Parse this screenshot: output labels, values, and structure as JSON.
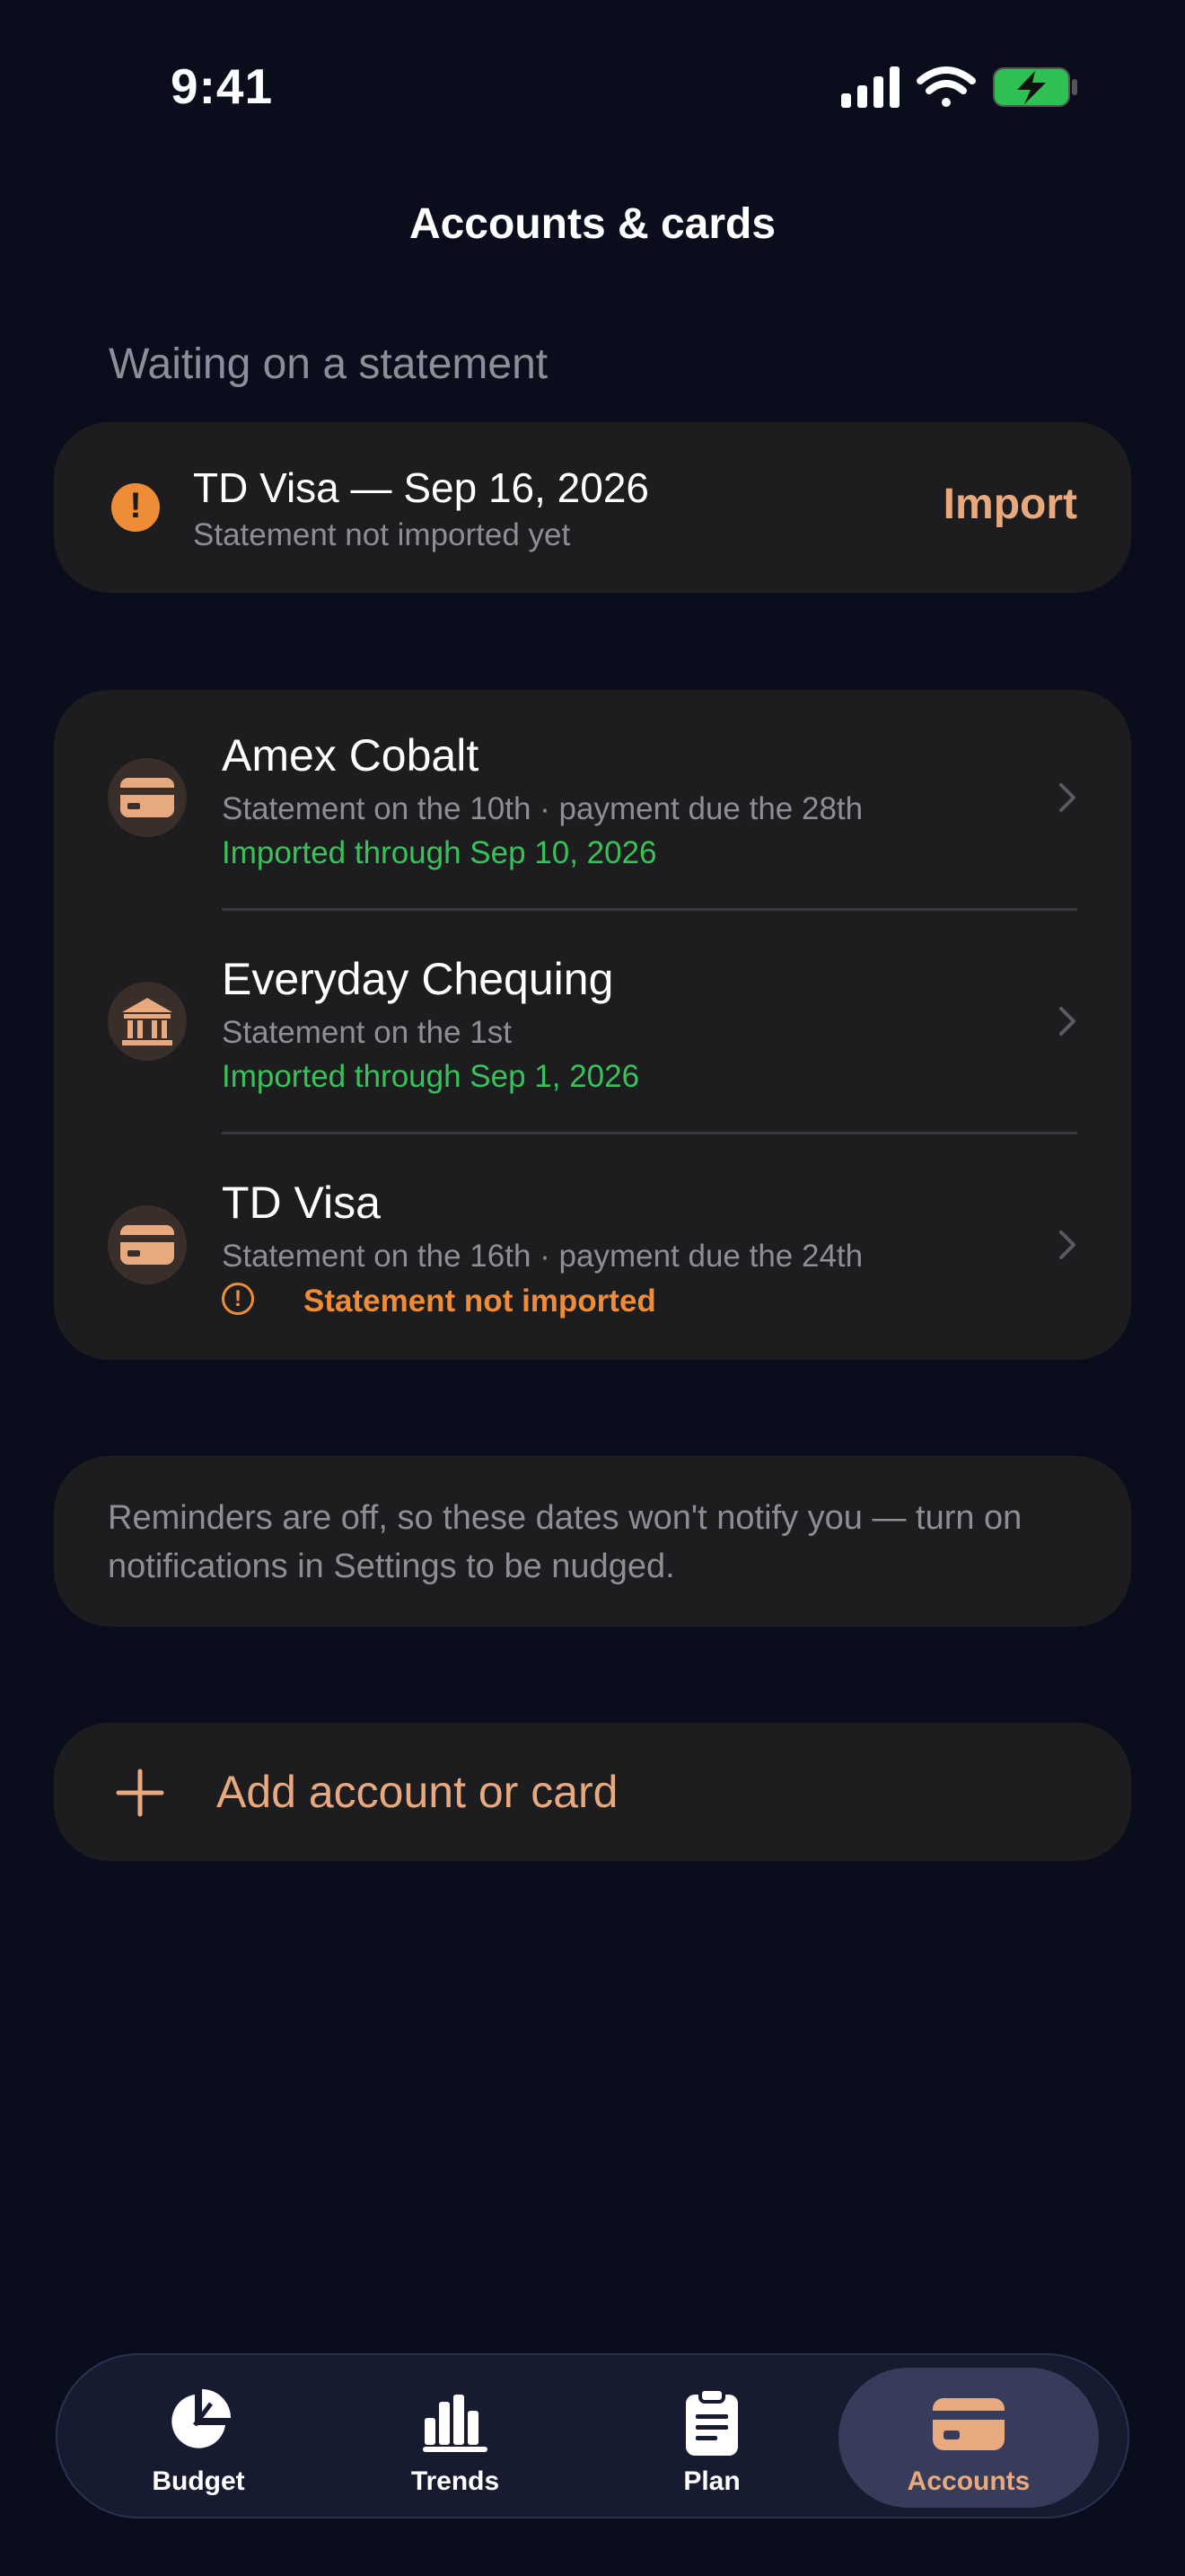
{
  "status_bar": {
    "time": "9:41"
  },
  "nav": {
    "title": "Accounts & cards"
  },
  "waiting": {
    "section_label": "Waiting on a statement",
    "item": {
      "title": "TD Visa — Sep 16, 2026",
      "subtitle": "Statement not imported yet",
      "action": "Import"
    }
  },
  "accounts": [
    {
      "name": "Amex Cobalt",
      "schedule": "Statement on the 10th · payment due the 28th",
      "status": "Imported through Sep 10, 2026",
      "status_kind": "ok",
      "icon": "credit-card-icon"
    },
    {
      "name": "Everyday Chequing",
      "schedule": "Statement on the 1st",
      "status": "Imported through Sep 1, 2026",
      "status_kind": "ok",
      "icon": "bank-icon"
    },
    {
      "name": "TD Visa",
      "schedule": "Statement on the 16th · payment due the 24th",
      "status": "Statement not imported",
      "status_kind": "warning",
      "icon": "credit-card-icon"
    }
  ],
  "note": "Reminders are off, so these dates won't notify you — turn on notifications in Settings to be nudged.",
  "add": {
    "label": "Add account or card"
  },
  "tabs": [
    {
      "label": "Budget",
      "icon": "pie-chart-icon"
    },
    {
      "label": "Trends",
      "icon": "bar-chart-icon"
    },
    {
      "label": "Plan",
      "icon": "clipboard-icon"
    },
    {
      "label": "Accounts",
      "icon": "credit-card-icon",
      "active": true
    }
  ],
  "colors": {
    "background": "#0a0e1c",
    "card": "#1d1d1f",
    "accent": "#e9a97f",
    "success": "#38c25a",
    "warning": "#ef8c37"
  }
}
